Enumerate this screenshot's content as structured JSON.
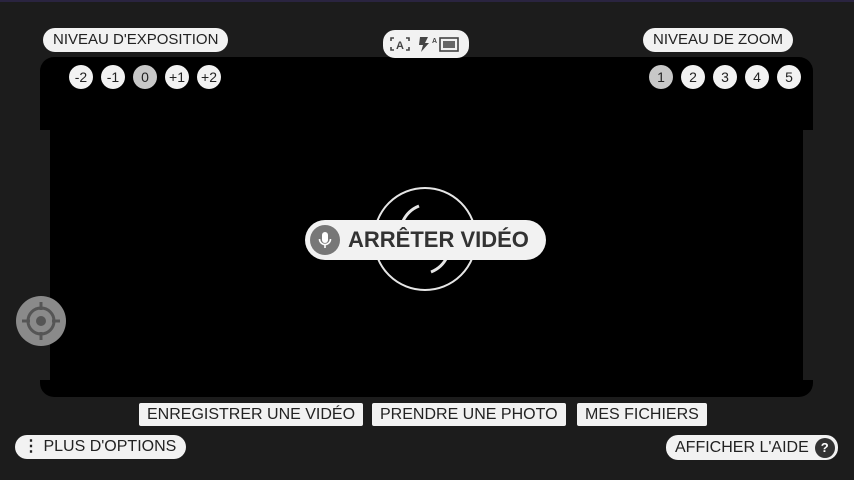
{
  "exposure": {
    "label": "NIVEAU D'EXPOSITION",
    "levels": [
      "-2",
      "-1",
      "0",
      "+1",
      "+2"
    ],
    "selected": "0"
  },
  "zoom": {
    "label": "NIVEAU DE ZOOM",
    "levels": [
      "1",
      "2",
      "3",
      "4",
      "5"
    ],
    "selected": "1"
  },
  "modes": {
    "icons": [
      "auto-focus-icon",
      "flash-auto-icon",
      "aspect-ratio-icon"
    ]
  },
  "record": {
    "stop_label": "ARRÊTER VIDÉO",
    "icon": "microphone-icon"
  },
  "bottom_menu": {
    "record_video": "ENREGISTRER UNE VIDÉO",
    "take_photo": "PRENDRE UNE PHOTO",
    "my_files": "MES FICHIERS"
  },
  "more_options": {
    "label": "PLUS D'OPTIONS",
    "icon": "more-vertical-icon"
  },
  "help": {
    "label": "AFFICHER L'AIDE",
    "icon": "help-icon",
    "glyph": "?"
  },
  "target_icon": "crosshair-target-icon",
  "colors": {
    "background": "#1c1c1c",
    "viewport": "#000000",
    "pill": "#f2f2f2"
  }
}
